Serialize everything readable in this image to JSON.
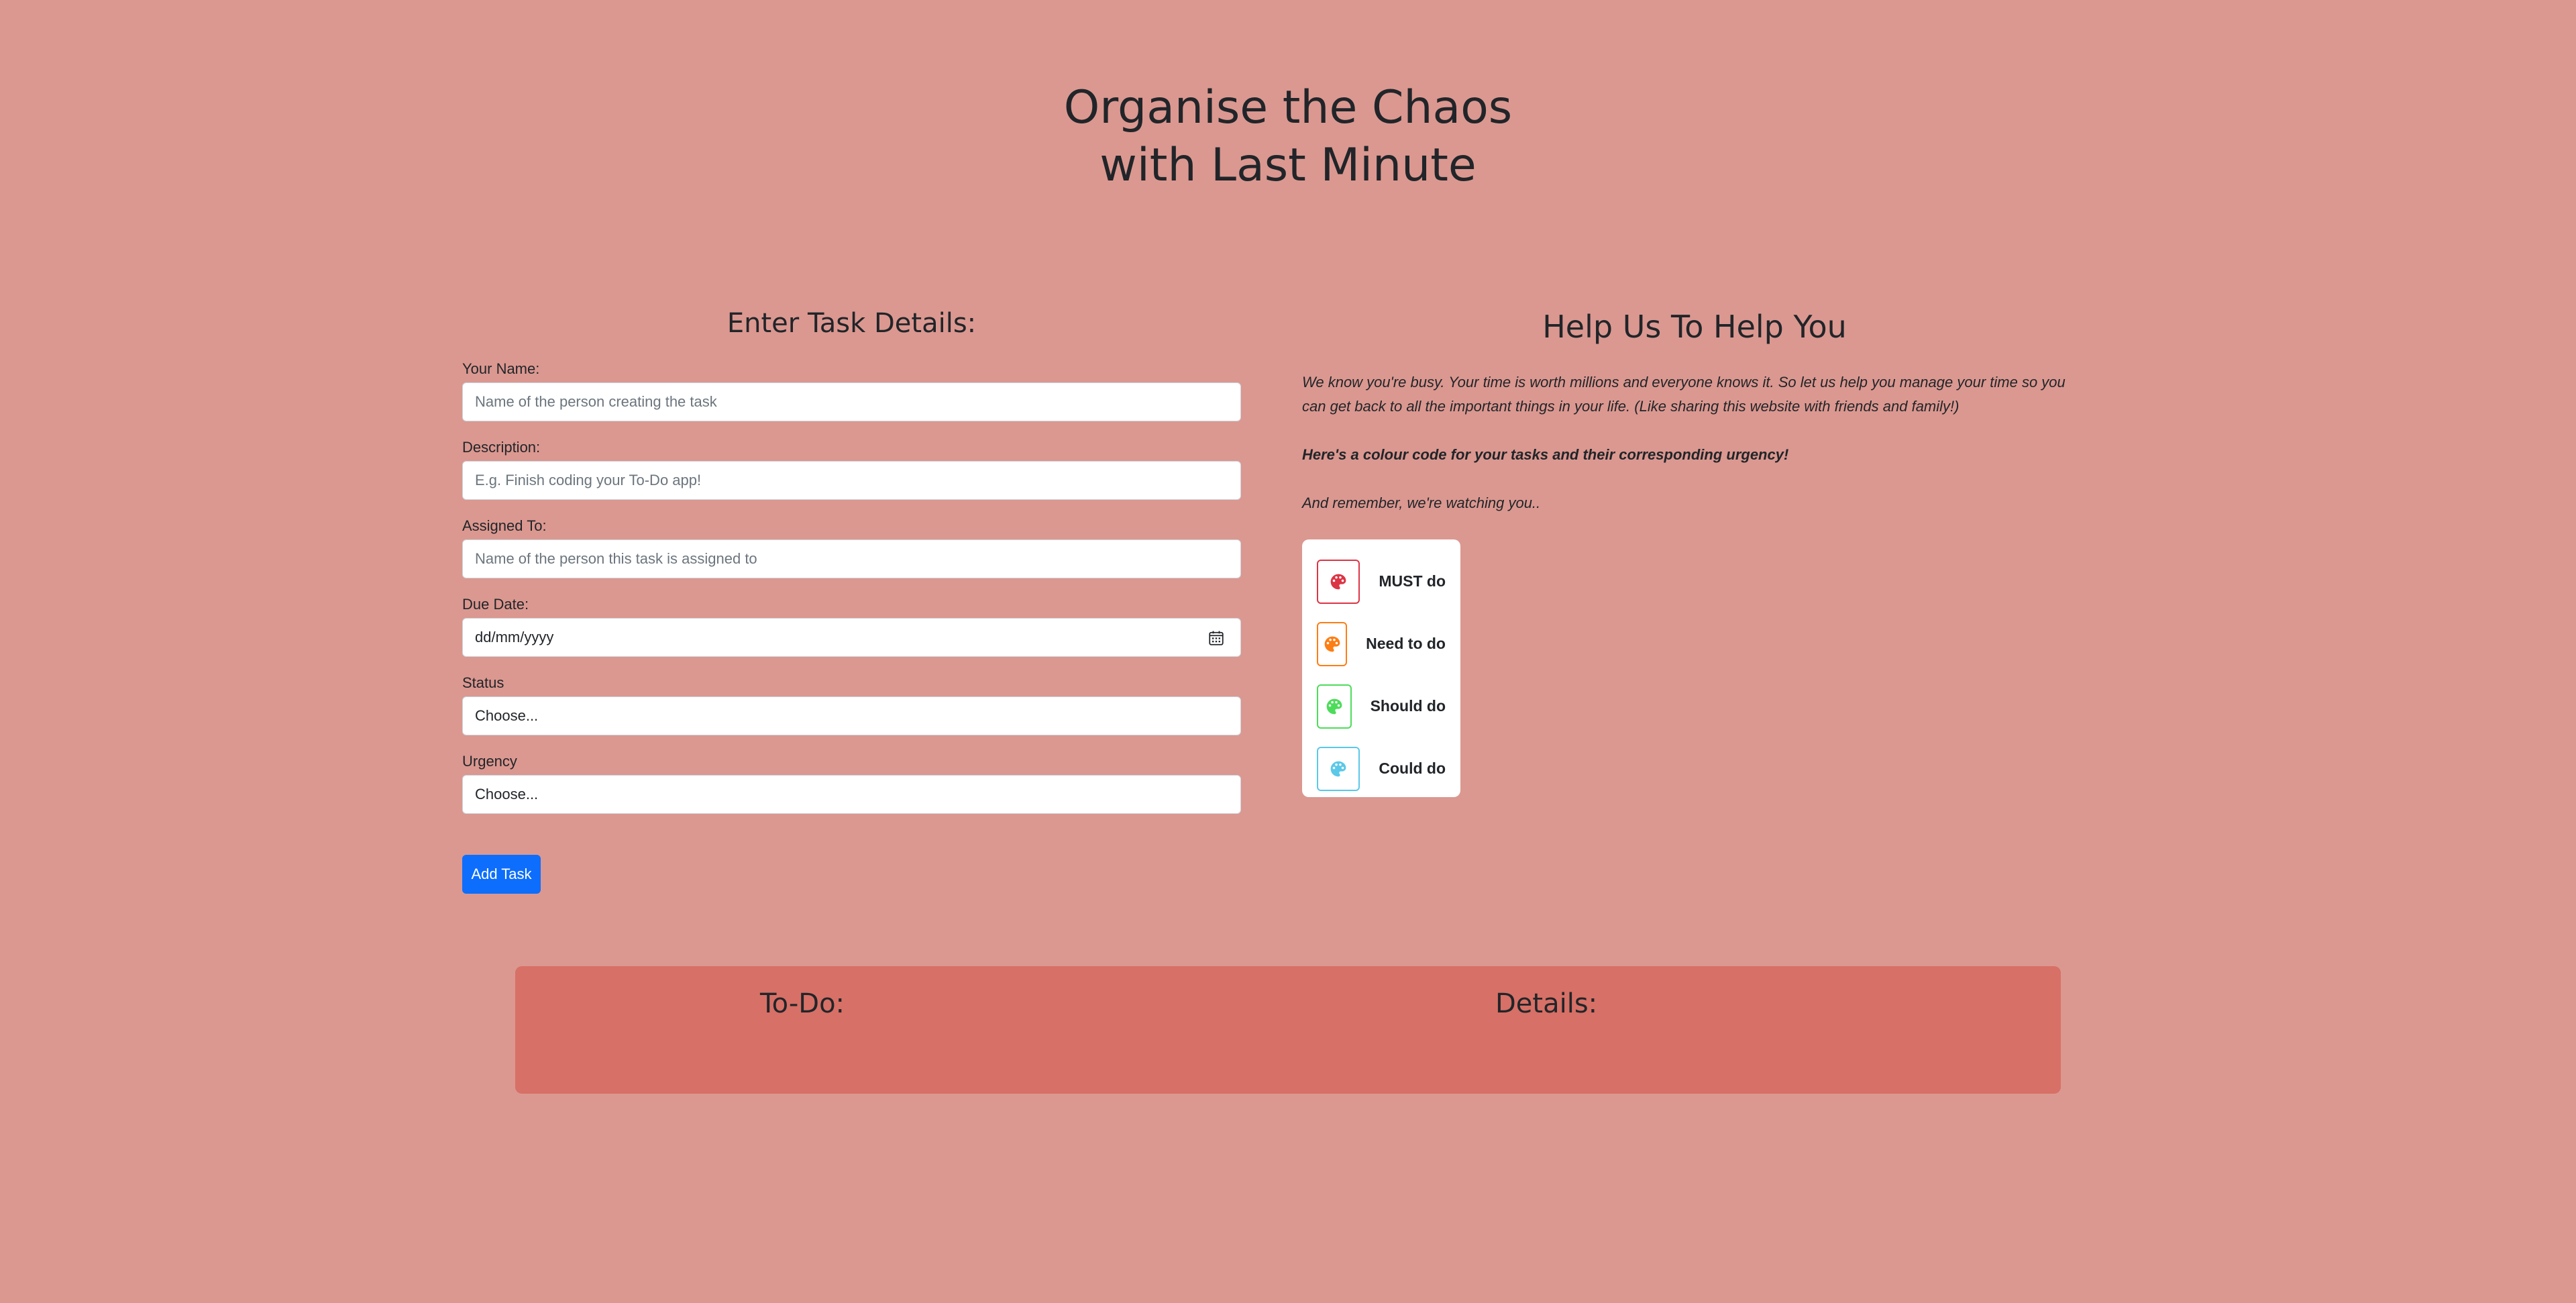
{
  "title": {
    "line1": "Organise the Chaos",
    "line2": "with Last Minute"
  },
  "form": {
    "heading": "Enter Task Details:",
    "name": {
      "label": "Your Name:",
      "placeholder": "Name of the person creating the task"
    },
    "description": {
      "label": "Description:",
      "placeholder": "E.g. Finish coding your To-Do app!"
    },
    "assigned_to": {
      "label": "Assigned To:",
      "placeholder": "Name of the person this task is assigned to"
    },
    "due_date": {
      "label": "Due Date:",
      "value": "dd/mm/yyyy"
    },
    "status": {
      "label": "Status",
      "value": "Choose..."
    },
    "urgency": {
      "label": "Urgency",
      "value": "Choose..."
    },
    "submit_label": "Add Task"
  },
  "help": {
    "heading": "Help Us To Help You",
    "intro": "We know you're busy. Your time is worth millions and everyone knows it. So let us help you manage your time so you can get back to all the important things in your life. (Like sharing this website with friends and family!)",
    "colour_code": "Here's a colour code for your tasks and their corresponding urgency!",
    "remember": "And remember, we're watching you..",
    "legend": [
      {
        "label": "MUST do",
        "color": "#dc3545",
        "icon": "palette-icon"
      },
      {
        "label": "Need to do",
        "color": "#fd7e14",
        "icon": "palette-icon"
      },
      {
        "label": "Should do",
        "color": "#4ddc5a",
        "icon": "palette-icon"
      },
      {
        "label": "Could do",
        "color": "#5bc8e8",
        "icon": "palette-icon"
      }
    ]
  },
  "board": {
    "todo_heading": "To-Do:",
    "details_heading": "Details:"
  },
  "colors": {
    "background": "#db9890",
    "panel": "#d77066",
    "primary_button": "#0d6efd"
  }
}
